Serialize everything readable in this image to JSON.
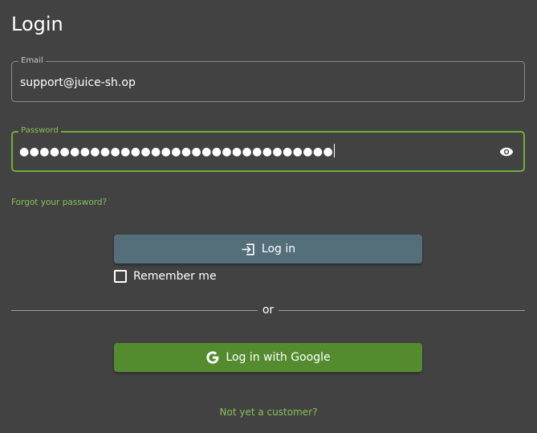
{
  "page": {
    "title": "Login"
  },
  "email": {
    "label": "Email",
    "value": "support@juice-sh.op"
  },
  "password": {
    "label": "Password",
    "masked_value": "●●●●●●●●●●●●●●●●●●●●●●●●●●●●●●●",
    "toggle_icon": "eye-icon"
  },
  "links": {
    "forgot_password": "Forgot your password?",
    "not_customer": "Not yet a customer?"
  },
  "buttons": {
    "login_label": "Log in",
    "login_icon": "login-icon",
    "google_label": "Log in with Google",
    "google_icon": "google-g-icon"
  },
  "remember": {
    "label": "Remember me",
    "checked": false
  },
  "divider": {
    "text": "or"
  },
  "colors": {
    "background": "#424242",
    "accent_green": "#88c057",
    "focus_border": "#6fae3c",
    "login_button": "#546e7a",
    "google_button": "#558b2f"
  }
}
